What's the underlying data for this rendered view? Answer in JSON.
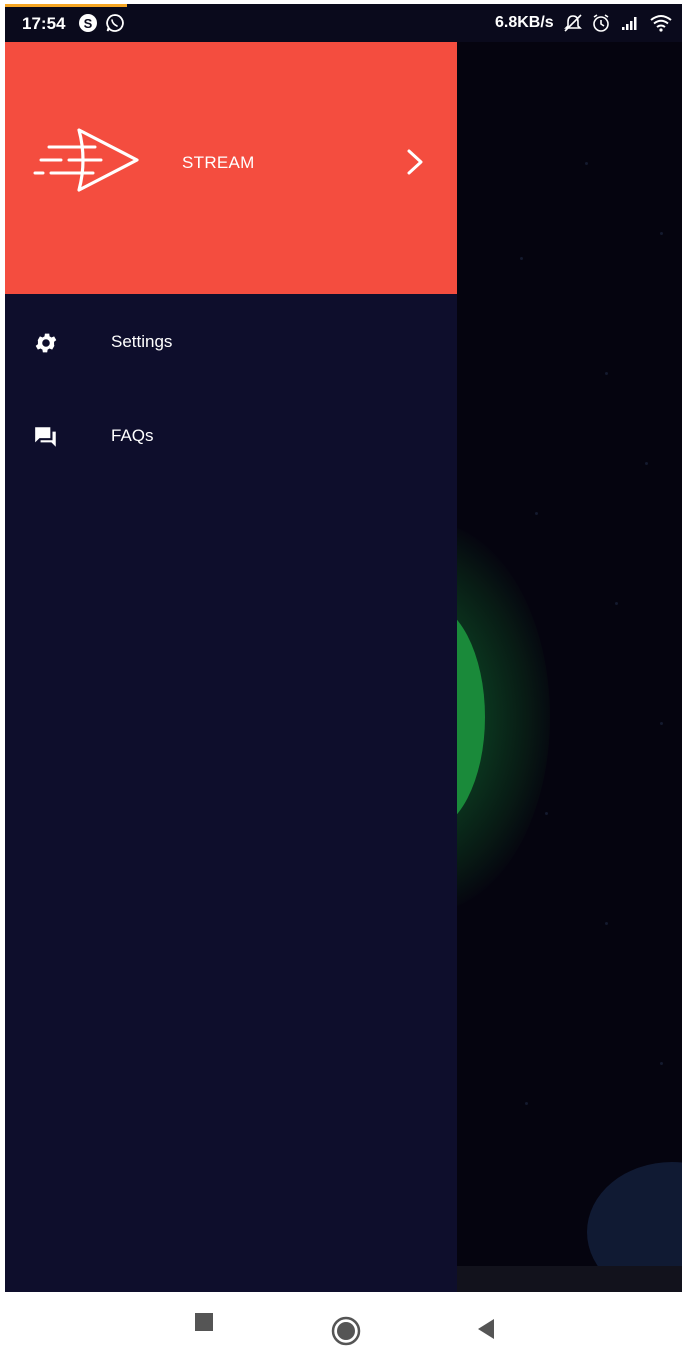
{
  "status_bar": {
    "time": "17:54",
    "speed": "6.8KB/s",
    "left_icons": [
      "skype-icon",
      "whatsapp-icon"
    ],
    "right_icons": [
      "notifications-off-icon",
      "alarm-icon",
      "signal-icon",
      "wifi-icon"
    ]
  },
  "drawer": {
    "header": {
      "brand_name": "STREAM",
      "logo": "paper-plane-logo",
      "chevron": "chevron-right-icon",
      "background_color": "#f44d3f"
    },
    "items": [
      {
        "label": "Settings",
        "icon": "gear-icon"
      },
      {
        "label": "FAQs",
        "icon": "chat-bubbles-icon"
      }
    ],
    "background_color": "#0e0e2c"
  },
  "nav_bar": {
    "buttons": [
      "recents-button",
      "home-button",
      "back-button"
    ]
  }
}
